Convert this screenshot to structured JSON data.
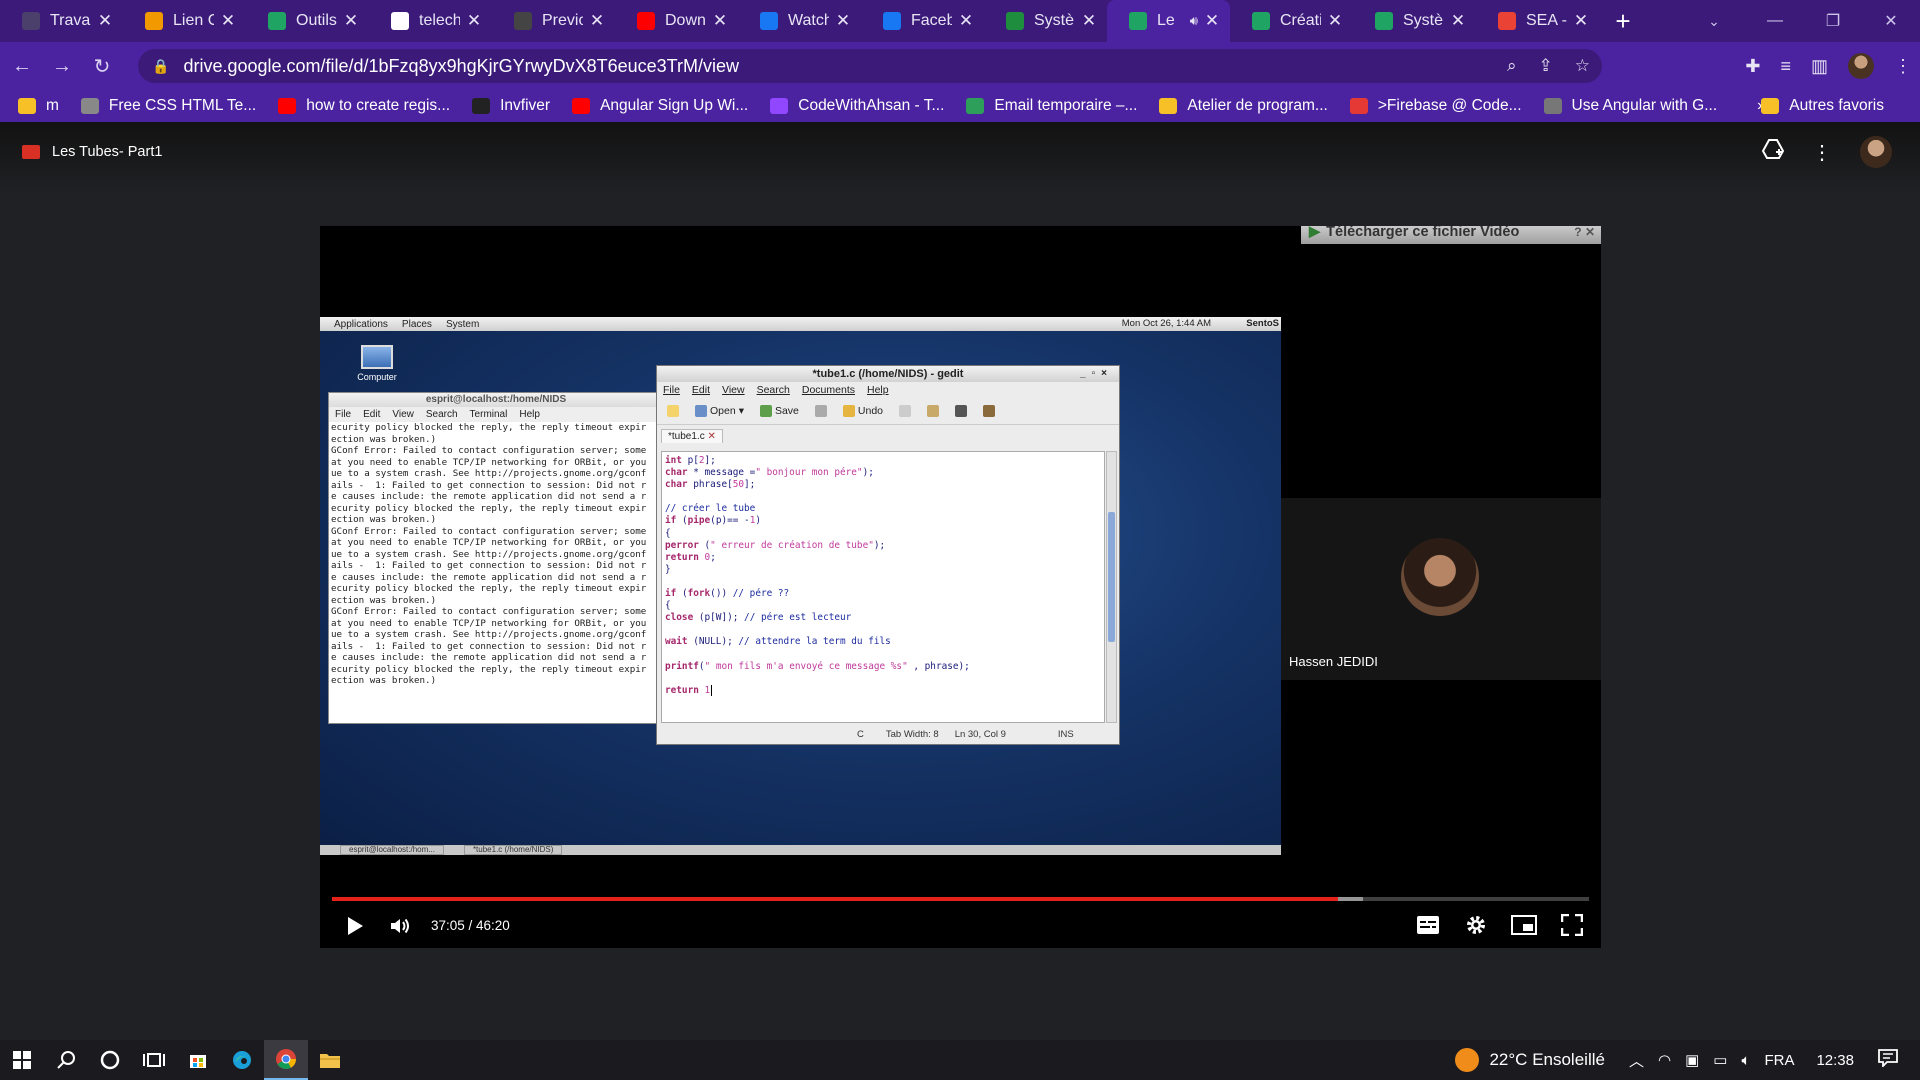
{
  "browser": {
    "tabs": [
      {
        "label": "Travau",
        "fav": "gallery",
        "color": "#4b3f6b",
        "active": false
      },
      {
        "label": "Lien C",
        "fav": "slides",
        "color": "#f29900",
        "active": false
      },
      {
        "label": "Outils",
        "fav": "drive",
        "color": "#1fa463",
        "active": false
      },
      {
        "label": "telech",
        "fav": "google",
        "color": "#ffffff",
        "active": false
      },
      {
        "label": "Previo",
        "fav": "github",
        "color": "#444444",
        "active": false
      },
      {
        "label": "Down",
        "fav": "youtube",
        "color": "#ff0000",
        "active": false
      },
      {
        "label": "Watch",
        "fav": "facebook",
        "color": "#1877f2",
        "active": false
      },
      {
        "label": "Faceb",
        "fav": "facebook",
        "color": "#1877f2",
        "active": false
      },
      {
        "label": "Systèn",
        "fav": "classroom",
        "color": "#1e8e3e",
        "active": false
      },
      {
        "label": "Le",
        "fav": "drive",
        "color": "#1fa463",
        "active": true
      },
      {
        "label": "Créati",
        "fav": "drive",
        "color": "#1fa463",
        "active": false
      },
      {
        "label": "Systèr",
        "fav": "drive",
        "color": "#1fa463",
        "active": false
      },
      {
        "label": "SEA -",
        "fav": "gmail",
        "color": "#ea4335",
        "active": false
      }
    ],
    "url": "drive.google.com/file/d/1bFzq8yx9hgKjrGYrwyDvX8T6euce3TrM/view",
    "bookmarks": [
      {
        "label": "m",
        "color": "#f6c026"
      },
      {
        "label": "Free CSS HTML Te...",
        "color": "#888888"
      },
      {
        "label": "how to create regis...",
        "color": "#ff0000"
      },
      {
        "label": "Invfiver",
        "color": "#222222"
      },
      {
        "label": "Angular Sign Up Wi...",
        "color": "#ff0000"
      },
      {
        "label": "CodeWithAhsan - T...",
        "color": "#9146ff"
      },
      {
        "label": "Email temporaire –...",
        "color": "#2e9e5b"
      },
      {
        "label": "Atelier de program...",
        "color": "#f6c026"
      },
      {
        "label": ">Firebase @ Code...",
        "color": "#e53935"
      },
      {
        "label": "Use Angular with G...",
        "color": "#777777"
      }
    ],
    "bookmarks_more": "»",
    "other_bookmarks": "Autres favoris"
  },
  "viewer": {
    "file_title": "Les Tubes- Part1",
    "download_label": "Télécharger ce fichier Vidéo",
    "participant_name": "Hassen JEDIDI",
    "time_current": "37:05",
    "time_total": "46:20",
    "time_display": "37:05 / 46:20",
    "progress_fraction": 0.8,
    "buffered_fraction": 0.82
  },
  "vm": {
    "topbar_items": [
      "Applications",
      "Places",
      "System"
    ],
    "clock": "Mon Oct 26,  1:44 AM",
    "user": "SentoS",
    "desktop_icon": "Computer",
    "terminal": {
      "title": "esprit@localhost:/home/NIDS",
      "menu": [
        "File",
        "Edit",
        "View",
        "Search",
        "Terminal",
        "Help"
      ],
      "lines": [
        "ecurity policy blocked the reply, the reply timeout expir",
        "ection was broken.)",
        "GConf Error: Failed to contact configuration server; some",
        "at you need to enable TCP/IP networking for ORBit, or you",
        "ue to a system crash. See http://projects.gnome.org/gconf",
        "ails -  1: Failed to get connection to session: Did not r",
        "e causes include: the remote application did not send a r",
        "ecurity policy blocked the reply, the reply timeout expir",
        "ection was broken.)",
        "GConf Error: Failed to contact configuration server; some",
        "at you need to enable TCP/IP networking for ORBit, or you",
        "ue to a system crash. See http://projects.gnome.org/gconf",
        "ails -  1: Failed to get connection to session: Did not r",
        "e causes include: the remote application did not send a r",
        "ecurity policy blocked the reply, the reply timeout expir",
        "ection was broken.)",
        "GConf Error: Failed to contact configuration server; some",
        "at you need to enable TCP/IP networking for ORBit, or you",
        "ue to a system crash. See http://projects.gnome.org/gconf",
        "ails -  1: Failed to get connection to session: Did not r",
        "e causes include: the remote application did not send a r",
        "ecurity policy blocked the reply, the reply timeout expir",
        "ection was broken.)"
      ]
    },
    "gedit": {
      "title": "*tube1.c (/home/NIDS) - gedit",
      "menu": [
        "File",
        "Edit",
        "View",
        "Search",
        "Documents",
        "Help"
      ],
      "toolbar": {
        "open": "Open",
        "save": "Save",
        "undo": "Undo"
      },
      "tab": "*tube1.c",
      "code": [
        "int p[2];",
        "char * message =\" bonjour mon pére\");",
        "char phrase[50];",
        "",
        "// créer le tube",
        "if (pipe(p)== -1)",
        "{",
        "perror (\" erreur de création de tube\");",
        "return 0;",
        "}",
        "",
        "if (fork()) // pére ??",
        "{",
        "close (p[W]); // pére est lecteur",
        "",
        "wait (NULL); // attendre la term du fils",
        "",
        "printf(\" mon fils m'a envoyé ce message %s\" , phrase);",
        "",
        "return 1"
      ],
      "status_lang": "C",
      "status_tab": "Tab Width: 8",
      "status_pos": "Ln 30, Col 9",
      "status_mode": "INS"
    },
    "bottombar": [
      "esprit@localhost:/hom...",
      "*tube1.c (/home/NIDS)"
    ]
  },
  "taskbar": {
    "weather_temp": "22°C",
    "weather_text": "Ensoleillé",
    "language": "FRA",
    "time": "12:38"
  }
}
